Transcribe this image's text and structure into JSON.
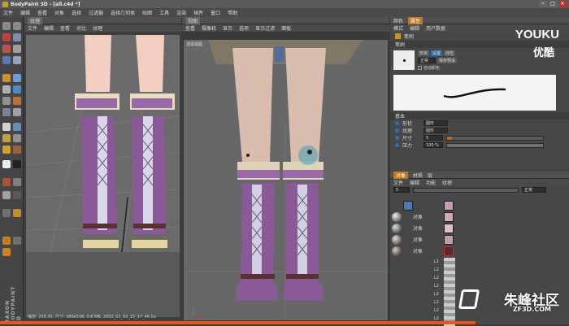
{
  "window": {
    "title": "BodyPaint 3D - [all.c4d *]",
    "controls": [
      "–",
      "□",
      "×"
    ]
  },
  "menu": [
    "文件",
    "编辑",
    "查看",
    "对象",
    "选择",
    "过滤器",
    "选择几何体",
    "贴图",
    "工具",
    "渲染",
    "插件",
    "窗口",
    "帮助"
  ],
  "left_panel": {
    "tab": "纹理",
    "menu": [
      "文件",
      "编辑",
      "查看",
      "对比",
      "纹理"
    ],
    "vertical_brand": "MAXON BODYPAINT 3D"
  },
  "viewport": {
    "tab": "视图",
    "menu": [
      "查看",
      "摄像机",
      "显示",
      "选项",
      "显示过滤",
      "面板"
    ],
    "label": "透视视图"
  },
  "right_panel": {
    "tabs": [
      "颜色",
      "属性"
    ],
    "submenu": [
      "模式",
      "编辑",
      "用户数据"
    ],
    "tool_name": "笔刷",
    "section_brush": "笔刷",
    "brush_buttons": [
      "形状",
      "设置",
      "线性"
    ],
    "brush_mode": "正常",
    "brush_option": "保存预设",
    "brush_checkbox": "自动颜色",
    "section_basic": "基本",
    "props": [
      {
        "label": "形状",
        "value": "圆形"
      },
      {
        "label": "纹理",
        "value": "圆形"
      },
      {
        "label": "尺寸",
        "value": "5",
        "fill": 0.05
      },
      {
        "label": "压力",
        "value": "100 %",
        "fill": 1.0
      }
    ],
    "layer_tabs": [
      "对象",
      "材质",
      "层"
    ],
    "layer_menu": [
      "文件",
      "编辑",
      "功能",
      "纹理"
    ],
    "layer_mode": "正常",
    "objects": [
      {
        "name": "对象"
      },
      {
        "name": "对象"
      },
      {
        "name": "对象"
      },
      {
        "name": "对象"
      }
    ],
    "layer_items": [
      "L1",
      "L2",
      "L2",
      "L2",
      "L2",
      "L2",
      "L2",
      "L2"
    ]
  },
  "status_bar": "缩放: 255.35, 尺寸: 380x536, 0.8 MB, 2002_01_02_15_17_46 5o",
  "watermarks": {
    "youku": "YOUKU",
    "youku_cn": "优酷",
    "site_cn": "朱峰社区",
    "site_en": "ZF3D.COM"
  }
}
